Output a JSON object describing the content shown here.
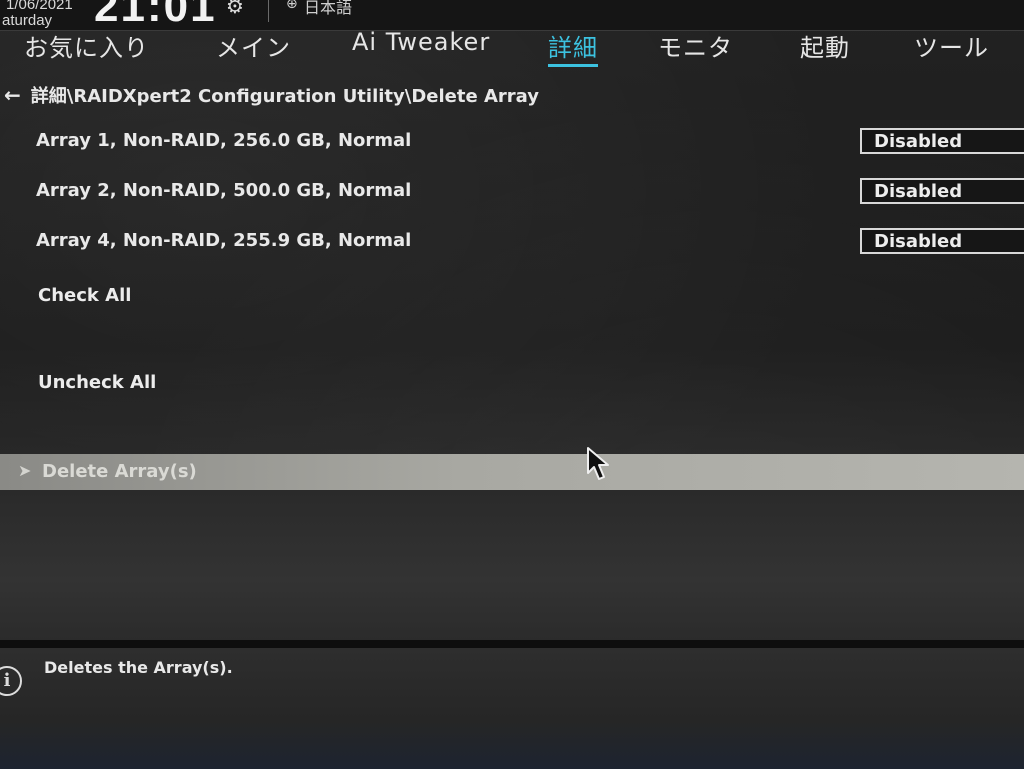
{
  "status": {
    "date": "1/06/2021",
    "weekday": "aturday",
    "time": "21:01",
    "language": "日本語"
  },
  "tabs": [
    {
      "label": "お気に入り",
      "active": false
    },
    {
      "label": "メイン",
      "active": false
    },
    {
      "label": "Ai Tweaker",
      "active": false
    },
    {
      "label": "詳細",
      "active": true
    },
    {
      "label": "モニタ",
      "active": false
    },
    {
      "label": "起動",
      "active": false
    },
    {
      "label": "ツール",
      "active": false
    }
  ],
  "breadcrumb": "詳細\\RAIDXpert2 Configuration Utility\\Delete Array",
  "arrays": [
    {
      "label": "Array 1, Non-RAID, 256.0 GB, Normal",
      "value": "Disabled"
    },
    {
      "label": "Array 2, Non-RAID, 500.0 GB, Normal",
      "value": "Disabled"
    },
    {
      "label": "Array 4, Non-RAID, 255.9 GB, Normal",
      "value": "Disabled"
    }
  ],
  "actions": {
    "check_all": "Check All",
    "uncheck_all": "Uncheck All",
    "delete": "Delete Array(s)"
  },
  "help": {
    "text": "Deletes the Array(s)."
  },
  "icons": {
    "back": "back-arrow-icon",
    "gear": "gear-icon",
    "language": "globe-icon",
    "info": "info-icon",
    "chevron": "chevron-right-icon",
    "cursor": "mouse-pointer-icon"
  },
  "colors": {
    "accent": "#3cc2e0",
    "highlight_bar": "#a8a8a2"
  }
}
